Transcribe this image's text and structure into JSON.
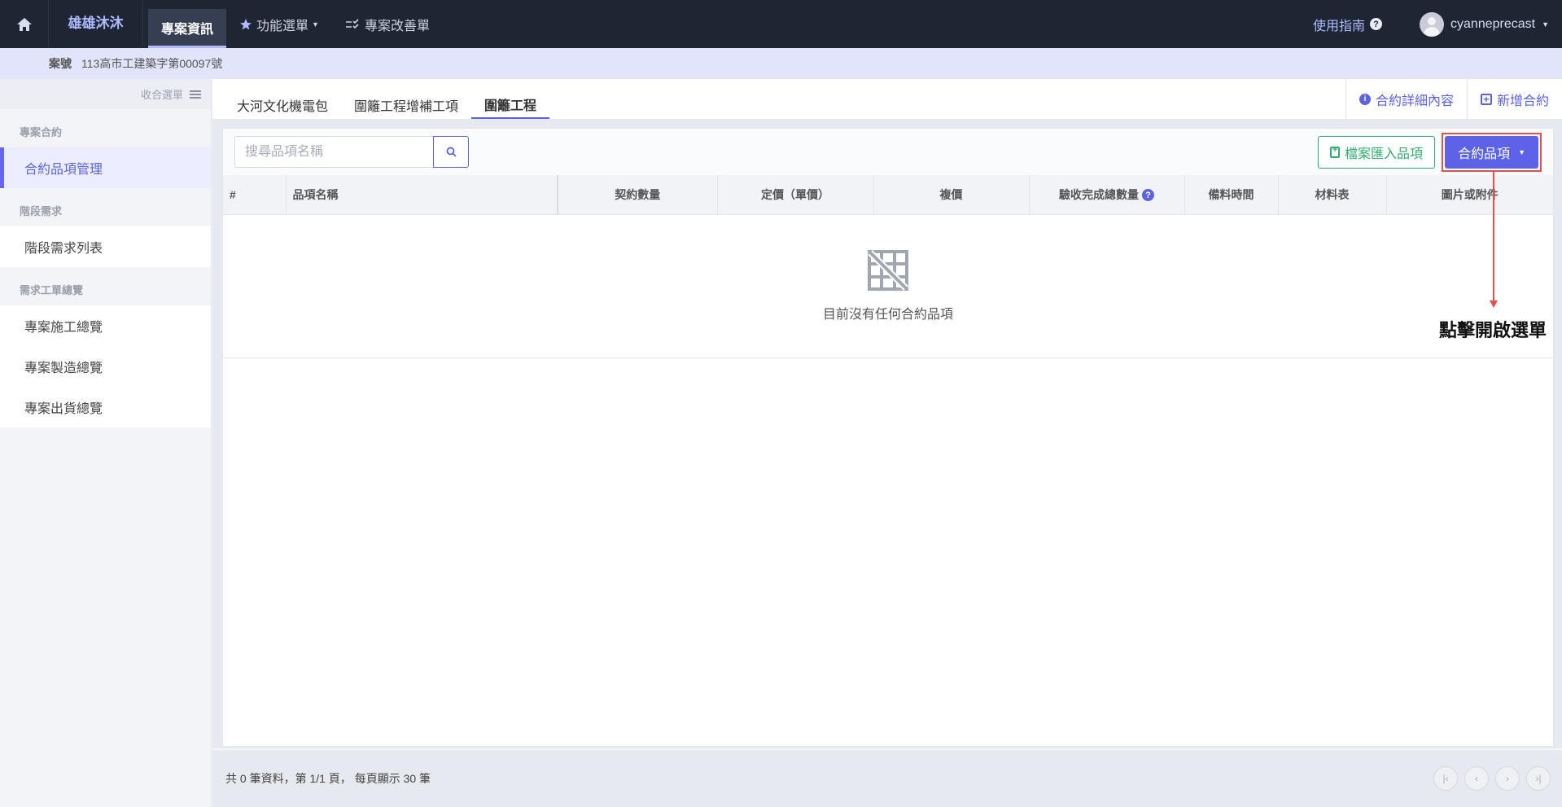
{
  "topnav": {
    "brand": "雄雄沐沐",
    "items": [
      {
        "label": "專案資訊",
        "active": true
      },
      {
        "label": "功能選單",
        "icon": "star-icon",
        "has_dropdown": true
      },
      {
        "label": "專案改善單",
        "icon": "checklist-icon"
      }
    ],
    "guide_label": "使用指南",
    "username": "cyanneprecast"
  },
  "case": {
    "label": "案號",
    "number": "113高市工建築字第00097號"
  },
  "sidebar": {
    "collapse_label": "收合選單",
    "sections": [
      {
        "title": "專案合約",
        "items": [
          {
            "label": "合約品項管理",
            "active": true
          }
        ]
      },
      {
        "title": "階段需求",
        "items": [
          {
            "label": "階段需求列表"
          }
        ]
      },
      {
        "title": "需求工單總覽",
        "items": [
          {
            "label": "專案施工總覽"
          },
          {
            "label": "專案製造總覽"
          },
          {
            "label": "專案出貨總覽"
          }
        ]
      }
    ]
  },
  "contract_tabs": [
    {
      "label": "大河文化機電包"
    },
    {
      "label": "圍籬工程增補工項"
    },
    {
      "label": "圍籬工程",
      "active": true
    }
  ],
  "tab_actions": {
    "details_label": "合約詳細內容",
    "add_label": "新增合約"
  },
  "toolbar": {
    "search_placeholder": "搜尋品項名稱",
    "import_label": "檔案匯入品項",
    "items_label": "合約品項"
  },
  "table": {
    "columns": [
      "#",
      "品項名稱",
      "契約數量",
      "定價（單價）",
      "複價",
      "驗收完成總數量",
      "備料時間",
      "材料表",
      "圖片或附件"
    ],
    "empty_text": "目前沒有任何合約品項"
  },
  "annotation": {
    "text": "點擊開啟選單",
    "color": "#e2514b"
  },
  "footer": {
    "summary": "共 0 筆資料，第 1/1 頁， 每頁顯示 30 筆"
  },
  "colors": {
    "accent": "#5d63e6",
    "topbar": "#1e2533",
    "import_green": "#2fae6f",
    "highlight_red": "#e2514b"
  }
}
